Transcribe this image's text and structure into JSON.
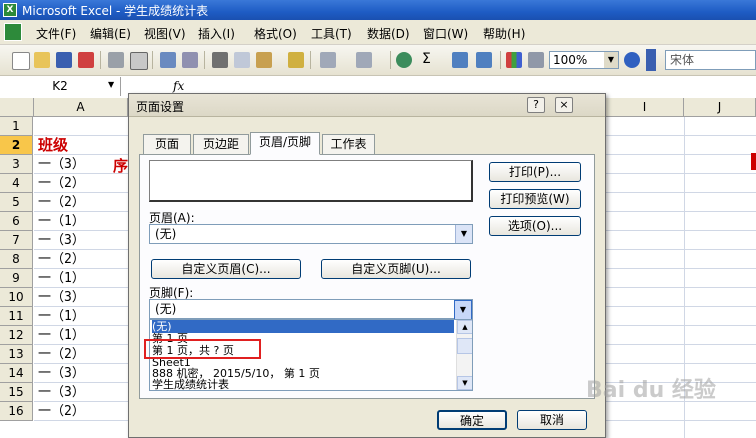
{
  "window": {
    "title": "Microsoft Excel - 学生成绩统计表",
    "app_icon": "excel-icon",
    "app_icon_letter": "X"
  },
  "menu": [
    "文件(F)",
    "编辑(E)",
    "视图(V)",
    "插入(I)",
    "格式(O)",
    "工具(T)",
    "数据(D)",
    "窗口(W)",
    "帮助(H)"
  ],
  "toolbar": {
    "zoom": "100%",
    "font": "宋体",
    "sum_symbol": "Σ"
  },
  "formula_bar": {
    "name_box": "K2",
    "fx": "fx"
  },
  "sheet": {
    "columns": [
      "A",
      "I",
      "J"
    ],
    "rows": [
      "1",
      "2",
      "3",
      "4",
      "5",
      "6",
      "7",
      "8",
      "9",
      "10",
      "11",
      "12",
      "13",
      "14",
      "15",
      "16"
    ],
    "colA": [
      "",
      "班级",
      "一（3）",
      "一（2）",
      "一（2）",
      "一（1）",
      "一（3）",
      "一（2）",
      "一（1）",
      "一（3）",
      "一（1）",
      "一（1）",
      "一（2）",
      "一（3）",
      "一（3）",
      "一（2）"
    ],
    "b2_partial": "序",
    "selected_row": "2",
    "header_color": "#cc0000"
  },
  "dialog": {
    "title": "页面设置",
    "help_button": "?",
    "close_button": "×",
    "tabs": [
      "页面",
      "页边距",
      "页眉/页脚",
      "工作表"
    ],
    "active_tab": "页眉/页脚",
    "header_label": "页眉(A):",
    "header_value": "(无)",
    "custom_header_button": "自定义页眉(C)...",
    "custom_footer_button": "自定义页脚(U)...",
    "footer_label": "页脚(F):",
    "footer_value": "(无)",
    "footer_options": [
      "(无)",
      "第 1 页",
      "第 1 页，共 ? 页",
      "Sheet1",
      "888 机密， 2015/5/10， 第 1 页",
      "学生成绩统计表"
    ],
    "highlighted_option_index": 0,
    "outlined_option_index": 2,
    "side_buttons": [
      "打印(P)...",
      "打印预览(W)",
      "选项(O)..."
    ],
    "ok_button": "确定",
    "cancel_button": "取消"
  },
  "watermark": "Bai du 经验"
}
